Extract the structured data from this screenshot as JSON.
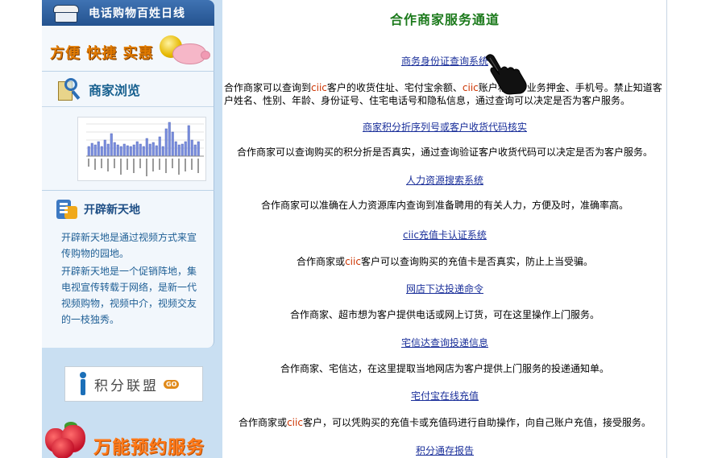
{
  "sidebar": {
    "hotline": "电话购物百姓日线",
    "promo_slogan": "方便 快捷 实惠",
    "browse_title": "商家浏览",
    "new_title": "开辟新天地",
    "new_desc_1": "开辟新天地是通过视频方式来宣传购物的园地。",
    "new_desc_2": "开辟新天地是一个促销阵地，集电视宣传转载于网络，是新一代视频购物，视频中介，视频交友的一枝独秀。",
    "jifen_label": "积分联盟",
    "jifen_go": "GO",
    "booking_label": "万能预约服务"
  },
  "main": {
    "title": "合作商家服务通道",
    "services": [
      {
        "link": "商务身份证查询系统",
        "desc_a": "合作商家可以查询到",
        "desc_b": "ciic",
        "desc_c": "客户的收货住址、宅付宝余额、",
        "desc_d": "ciic",
        "desc_e": "账户积分、业务押金、手机号。禁止知道客户姓名、性别、年龄、身份证号、住宅电话号和隐私信息，通过查询可以决定是否为客户服务。"
      },
      {
        "link": "商家积分折序列号或客户收货代码核实",
        "desc": "合作商家可以查询购买的积分折是否真实，通过查询验证客户收货代码可以决定是否为客户服务。"
      },
      {
        "link": "人力资源搜索系统",
        "desc": "合作商家可以准确在人力资源库内查询到准备聘用的有关人力，方便及时，准确率高。"
      },
      {
        "link_a": "ciic",
        "link_b": "充值卡认证系统",
        "desc_a": "合作商家或",
        "desc_b": "ciic",
        "desc_c": "客户可以查询购买的充值卡是否真实，防止上当受骗。"
      },
      {
        "link": "网店下达投递命令",
        "desc": "合作商家、超市想为客户提供电话或网上订货，可在这里操作上门服务。"
      },
      {
        "link": "宅信达查询投递信息",
        "desc": "合作商家、宅信达，在这里提取当地网店为客户提供上门服务的投递通知单。"
      },
      {
        "link": "宅付宝在线充值",
        "desc_a": "合作商家或",
        "desc_b": "ciic",
        "desc_c": "客户，可以凭购买的充值卡或充值码进行自助操作，向自己账户充值，接受服务。"
      },
      {
        "link": "积分通存报告"
      }
    ]
  },
  "colors": {
    "title_green": "#1c7a1c",
    "link_blue": "#1a2f9a",
    "ciic_red": "#cc3300",
    "sidebar_bg": "#c9dff2",
    "hotline_blue": "#2f62a2"
  },
  "icons": [
    "phone-icon",
    "coins-icon",
    "piggy-bank-icon",
    "magnifier-icon",
    "new-world-icon",
    "person-icon",
    "strawberry-icon",
    "hand-cursor-icon"
  ]
}
